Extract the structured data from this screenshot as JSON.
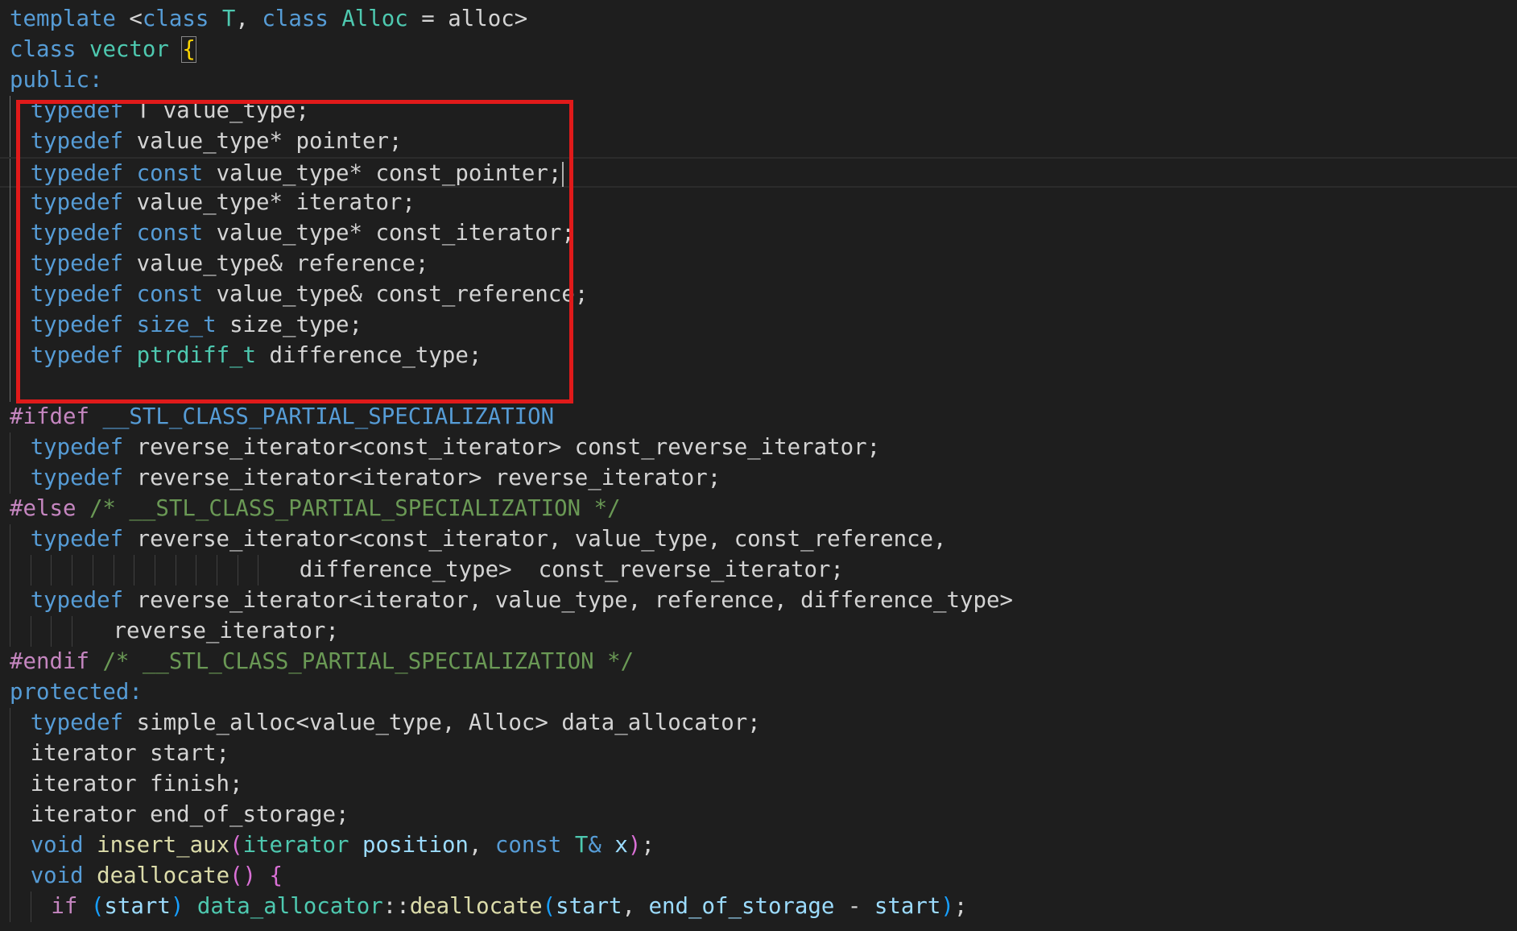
{
  "colors": {
    "background": "#1e1e1e",
    "default_text": "#d4d4d4",
    "keyword": "#569cd6",
    "type": "#4ec9b0",
    "preprocessor": "#c586c0",
    "macro": "#569cd6",
    "comment": "#6a9955",
    "function": "#dcdcaa",
    "variable": "#9cdcfe",
    "bracket_gold": "#ffd700",
    "bracket_purple": "#da70d6",
    "bracket_blue": "#179fff",
    "highlight_box": "#e01a1a"
  },
  "editor": {
    "language": "C++",
    "cursor_line": 6,
    "lines": [
      {
        "tokens": [
          {
            "t": "template",
            "c": "keyword"
          },
          {
            "t": " <",
            "c": "default_text"
          },
          {
            "t": "class",
            "c": "keyword"
          },
          {
            "t": " ",
            "c": "default_text"
          },
          {
            "t": "T",
            "c": "type"
          },
          {
            "t": ", ",
            "c": "default_text"
          },
          {
            "t": "class",
            "c": "keyword"
          },
          {
            "t": " ",
            "c": "default_text"
          },
          {
            "t": "Alloc",
            "c": "type"
          },
          {
            "t": " = alloc>",
            "c": "default_text"
          }
        ]
      },
      {
        "tokens": [
          {
            "t": "class",
            "c": "keyword"
          },
          {
            "t": " ",
            "c": "default_text"
          },
          {
            "t": "vector",
            "c": "type"
          },
          {
            "t": " ",
            "c": "default_text"
          },
          {
            "t": "{",
            "c": "bracket_gold",
            "match": true
          }
        ]
      },
      {
        "tokens": [
          {
            "t": "public:",
            "c": "keyword"
          }
        ]
      },
      {
        "indent": 1,
        "tokens": [
          {
            "t": "typedef",
            "c": "keyword"
          },
          {
            "t": " T value_type;",
            "c": "default_text"
          }
        ]
      },
      {
        "indent": 1,
        "tokens": [
          {
            "t": "typedef",
            "c": "keyword"
          },
          {
            "t": " value_type* pointer;",
            "c": "default_text"
          }
        ]
      },
      {
        "indent": 1,
        "caret": true,
        "tokens": [
          {
            "t": "typedef",
            "c": "keyword"
          },
          {
            "t": " ",
            "c": "default_text"
          },
          {
            "t": "const",
            "c": "keyword"
          },
          {
            "t": " value_type* const_pointer;",
            "c": "default_text"
          }
        ]
      },
      {
        "indent": 1,
        "tokens": [
          {
            "t": "typedef",
            "c": "keyword"
          },
          {
            "t": " value_type* iterator;",
            "c": "default_text"
          }
        ]
      },
      {
        "indent": 1,
        "tokens": [
          {
            "t": "typedef",
            "c": "keyword"
          },
          {
            "t": " ",
            "c": "default_text"
          },
          {
            "t": "const",
            "c": "keyword"
          },
          {
            "t": " value_type* const_iterator;",
            "c": "default_text"
          }
        ]
      },
      {
        "indent": 1,
        "tokens": [
          {
            "t": "typedef",
            "c": "keyword"
          },
          {
            "t": " value_type& reference;",
            "c": "default_text"
          }
        ]
      },
      {
        "indent": 1,
        "tokens": [
          {
            "t": "typedef",
            "c": "keyword"
          },
          {
            "t": " ",
            "c": "default_text"
          },
          {
            "t": "const",
            "c": "keyword"
          },
          {
            "t": " value_type& const_reference;",
            "c": "default_text"
          }
        ]
      },
      {
        "indent": 1,
        "tokens": [
          {
            "t": "typedef",
            "c": "keyword"
          },
          {
            "t": " ",
            "c": "default_text"
          },
          {
            "t": "size_t",
            "c": "keyword"
          },
          {
            "t": " size_type;",
            "c": "default_text"
          }
        ]
      },
      {
        "indent": 1,
        "tokens": [
          {
            "t": "typedef",
            "c": "keyword"
          },
          {
            "t": " ",
            "c": "default_text"
          },
          {
            "t": "ptrdiff_t",
            "c": "type"
          },
          {
            "t": " difference_type;",
            "c": "default_text"
          }
        ]
      },
      {
        "indent": 1,
        "tokens": []
      },
      {
        "tokens": [
          {
            "t": "#ifdef",
            "c": "preprocessor"
          },
          {
            "t": " ",
            "c": "default_text"
          },
          {
            "t": "__STL_CLASS_PARTIAL_SPECIALIZATION",
            "c": "macro"
          }
        ]
      },
      {
        "indent": 1,
        "tokens": [
          {
            "t": "typedef",
            "c": "keyword"
          },
          {
            "t": " reverse_iterator<const_iterator> const_reverse_iterator;",
            "c": "default_text"
          }
        ]
      },
      {
        "indent": 1,
        "tokens": [
          {
            "t": "typedef",
            "c": "keyword"
          },
          {
            "t": " reverse_iterator<iterator> reverse_iterator;",
            "c": "default_text"
          }
        ]
      },
      {
        "tokens": [
          {
            "t": "#else",
            "c": "preprocessor"
          },
          {
            "t": " /* __STL_CLASS_PARTIAL_SPECIALIZATION */",
            "c": "comment"
          }
        ]
      },
      {
        "indent": 1,
        "tokens": [
          {
            "t": "typedef",
            "c": "keyword"
          },
          {
            "t": " reverse_iterator<const_iterator, value_type, const_reference,",
            "c": "default_text"
          }
        ]
      },
      {
        "indent": 13,
        "pad": 1,
        "tokens": [
          {
            "t": "difference_type>  const_reverse_iterator;",
            "c": "default_text"
          }
        ]
      },
      {
        "indent": 1,
        "tokens": [
          {
            "t": "typedef",
            "c": "keyword"
          },
          {
            "t": " reverse_iterator<iterator, value_type, reference, difference_type>",
            "c": "default_text"
          }
        ]
      },
      {
        "indent": 4,
        "pad": 1,
        "tokens": [
          {
            "t": "reverse_iterator;",
            "c": "default_text"
          }
        ]
      },
      {
        "tokens": [
          {
            "t": "#endif",
            "c": "preprocessor"
          },
          {
            "t": " /* __STL_CLASS_PARTIAL_SPECIALIZATION */",
            "c": "comment"
          }
        ]
      },
      {
        "tokens": [
          {
            "t": "protected:",
            "c": "keyword"
          }
        ]
      },
      {
        "indent": 1,
        "tokens": [
          {
            "t": "typedef",
            "c": "keyword"
          },
          {
            "t": " simple_alloc<value_type, Alloc> data_allocator;",
            "c": "default_text"
          }
        ]
      },
      {
        "indent": 1,
        "tokens": [
          {
            "t": "iterator start;",
            "c": "default_text"
          }
        ]
      },
      {
        "indent": 1,
        "tokens": [
          {
            "t": "iterator finish;",
            "c": "default_text"
          }
        ]
      },
      {
        "indent": 1,
        "tokens": [
          {
            "t": "iterator end_of_storage;",
            "c": "default_text"
          }
        ]
      },
      {
        "indent": 1,
        "tokens": [
          {
            "t": "void",
            "c": "keyword"
          },
          {
            "t": " ",
            "c": "default_text"
          },
          {
            "t": "insert_aux",
            "c": "function"
          },
          {
            "t": "(",
            "c": "bracket_purple"
          },
          {
            "t": "iterator",
            "c": "type"
          },
          {
            "t": " ",
            "c": "default_text"
          },
          {
            "t": "position",
            "c": "variable"
          },
          {
            "t": ", ",
            "c": "default_text"
          },
          {
            "t": "const",
            "c": "keyword"
          },
          {
            "t": " ",
            "c": "default_text"
          },
          {
            "t": "T",
            "c": "type"
          },
          {
            "t": "&",
            "c": "keyword"
          },
          {
            "t": " ",
            "c": "default_text"
          },
          {
            "t": "x",
            "c": "variable"
          },
          {
            "t": ")",
            "c": "bracket_purple"
          },
          {
            "t": ";",
            "c": "default_text"
          }
        ]
      },
      {
        "indent": 1,
        "tokens": [
          {
            "t": "void",
            "c": "keyword"
          },
          {
            "t": " ",
            "c": "default_text"
          },
          {
            "t": "deallocate",
            "c": "function"
          },
          {
            "t": "()",
            "c": "bracket_purple"
          },
          {
            "t": " ",
            "c": "default_text"
          },
          {
            "t": "{",
            "c": "bracket_purple"
          }
        ]
      },
      {
        "indent": 2,
        "tokens": [
          {
            "t": "if",
            "c": "preprocessor"
          },
          {
            "t": " ",
            "c": "default_text"
          },
          {
            "t": "(",
            "c": "bracket_blue"
          },
          {
            "t": "start",
            "c": "variable"
          },
          {
            "t": ")",
            "c": "bracket_blue"
          },
          {
            "t": " ",
            "c": "default_text"
          },
          {
            "t": "data_allocator",
            "c": "type"
          },
          {
            "t": "::",
            "c": "default_text"
          },
          {
            "t": "deallocate",
            "c": "function"
          },
          {
            "t": "(",
            "c": "bracket_blue"
          },
          {
            "t": "start",
            "c": "variable"
          },
          {
            "t": ", ",
            "c": "default_text"
          },
          {
            "t": "end_of_storage",
            "c": "variable"
          },
          {
            "t": " - ",
            "c": "default_text"
          },
          {
            "t": "start",
            "c": "variable"
          },
          {
            "t": ")",
            "c": "bracket_blue"
          },
          {
            "t": ";",
            "c": "default_text"
          }
        ]
      }
    ]
  }
}
